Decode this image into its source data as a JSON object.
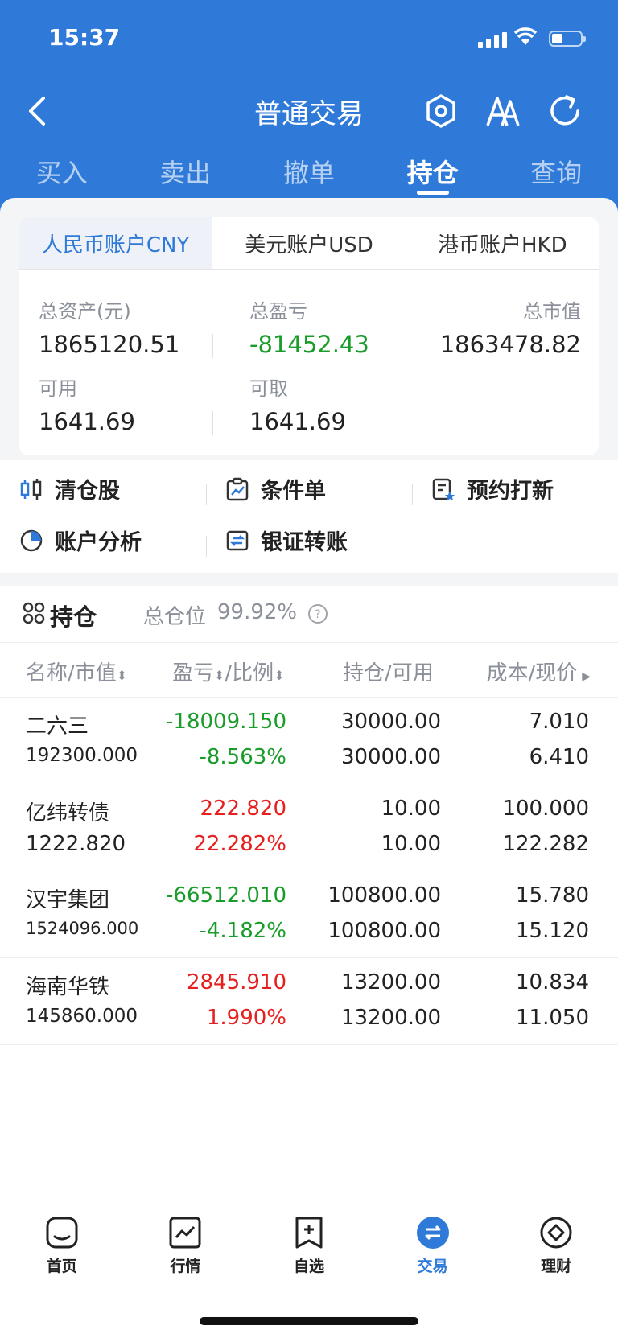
{
  "status_bar": {
    "time": "15:37"
  },
  "nav": {
    "title": "普通交易"
  },
  "tabs": [
    "买入",
    "卖出",
    "撤单",
    "持仓",
    "查询"
  ],
  "active_tab": "持仓",
  "accounts": [
    "人民币账户CNY",
    "美元账户USD",
    "港币账户HKD"
  ],
  "summary": {
    "total_assets_label": "总资产(元)",
    "total_assets": "1865120.51",
    "total_pl_label": "总盈亏",
    "total_pl": "-81452.43",
    "market_value_label": "总市值",
    "market_value": "1863478.82",
    "available_label": "可用",
    "available": "1641.69",
    "withdrawable_label": "可取",
    "withdrawable": "1641.69"
  },
  "quick_actions": [
    "清仓股",
    "条件单",
    "预约打新",
    "账户分析",
    "银证转账"
  ],
  "holdings": {
    "title": "持仓",
    "position_label": "总仓位",
    "position_value": "99.92%",
    "columns": [
      "名称/市值",
      "盈亏",
      "/比例",
      "持仓/可用",
      "成本/现价"
    ],
    "rows": [
      {
        "name": "二六三",
        "mv": "192300.000",
        "pl": "-18009.150",
        "ratio": "-8.563%",
        "hold": "30000.00",
        "avail": "30000.00",
        "cost": "7.010",
        "price": "6.410",
        "dir": "down"
      },
      {
        "name": "亿纬转债",
        "mv": "1222.820",
        "pl": "222.820",
        "ratio": "22.282%",
        "hold": "10.00",
        "avail": "10.00",
        "cost": "100.000",
        "price": "122.282",
        "dir": "up"
      },
      {
        "name": "汉宇集团",
        "mv": "1524096.000",
        "pl": "-66512.010",
        "ratio": "-4.182%",
        "hold": "100800.00",
        "avail": "100800.00",
        "cost": "15.780",
        "price": "15.120",
        "dir": "down"
      },
      {
        "name": "海南华铁",
        "mv": "145860.000",
        "pl": "2845.910",
        "ratio": "1.990%",
        "hold": "13200.00",
        "avail": "13200.00",
        "cost": "10.834",
        "price": "11.050",
        "dir": "up"
      }
    ]
  },
  "bottom_nav": [
    "首页",
    "行情",
    "自选",
    "交易",
    "理财"
  ],
  "bottom_active": "交易",
  "colors": {
    "primary": "#2f7ad9",
    "up": "#e61f1f",
    "down": "#1a9c2b"
  }
}
